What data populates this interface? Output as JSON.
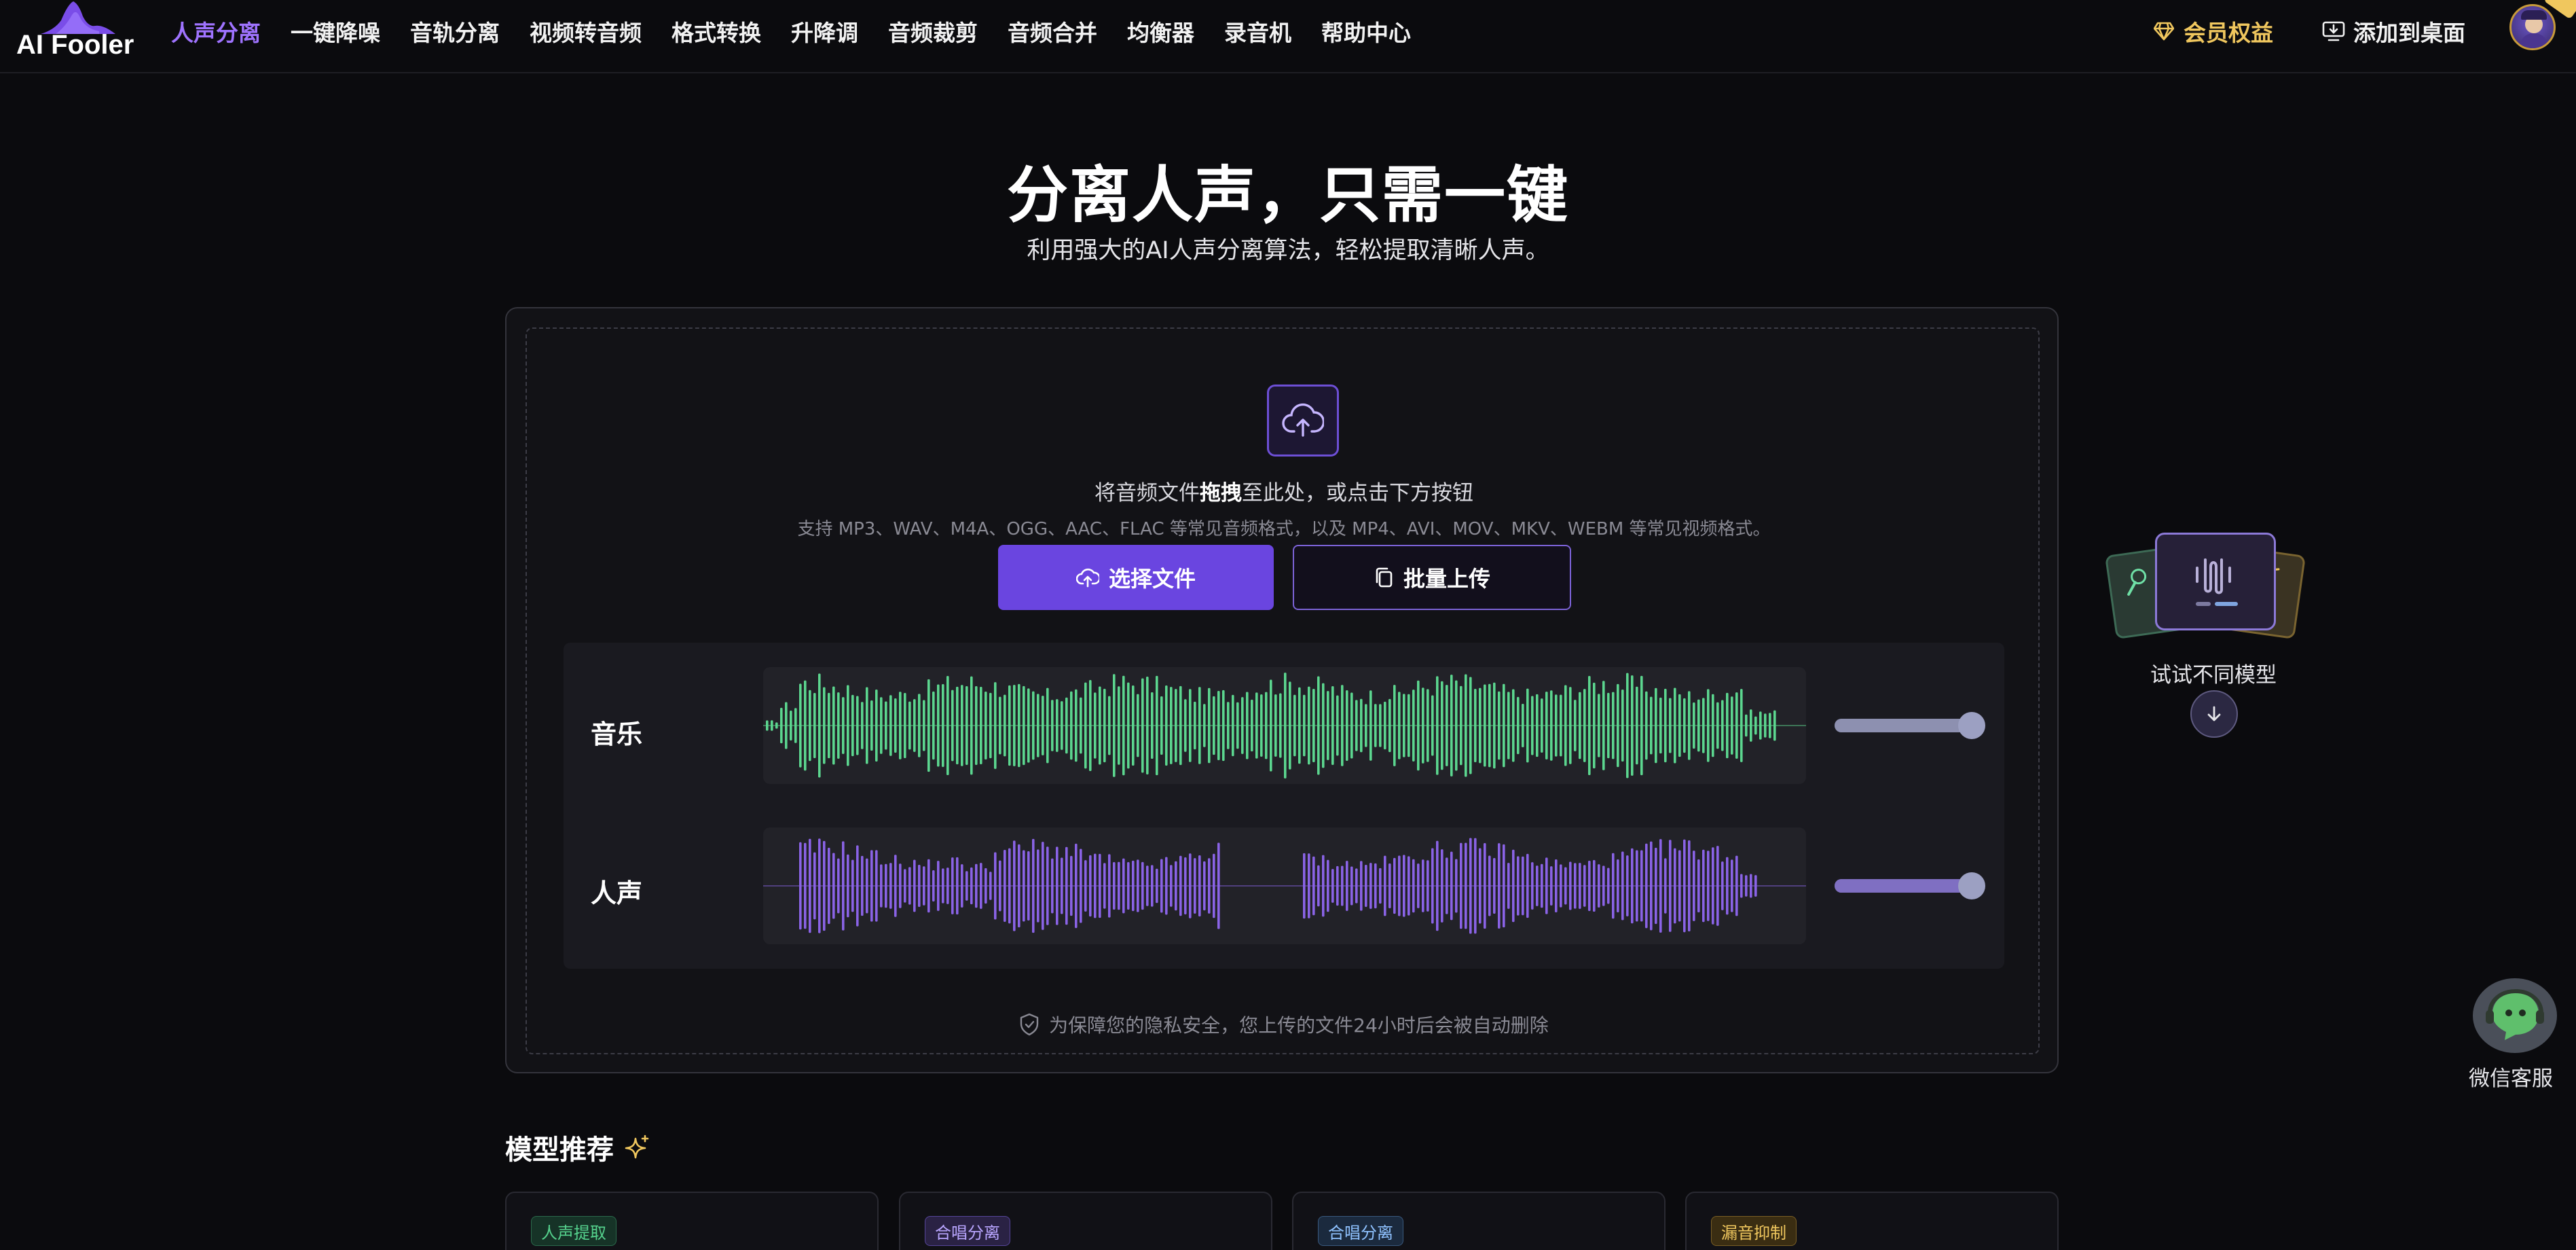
{
  "app": {
    "logo_text": "AI Fooler"
  },
  "nav": {
    "items": [
      {
        "label": "人声分离",
        "active": true
      },
      {
        "label": "一键降噪"
      },
      {
        "label": "音轨分离"
      },
      {
        "label": "视频转音频"
      },
      {
        "label": "格式转换"
      },
      {
        "label": "升降调"
      },
      {
        "label": "音频裁剪"
      },
      {
        "label": "音频合并"
      },
      {
        "label": "均衡器"
      },
      {
        "label": "录音机"
      },
      {
        "label": "帮助中心"
      }
    ],
    "vip_label": "会员权益",
    "add_desktop_label": "添加到桌面"
  },
  "hero": {
    "title": "分离人声，只需一键",
    "subtitle": "利用强大的AI人声分离算法，轻松提取清晰人声。"
  },
  "upload": {
    "drop_prefix": "将音频文件",
    "drop_bold": "拖拽",
    "drop_suffix": "至此处，或点击下方按钮",
    "formats": "支持 MP3、WAV、M4A、OGG、AAC、FLAC 等常见音频格式，以及 MP4、AVI、MOV、MKV、WEBM 等常见视频格式。",
    "select_button": "选择文件",
    "batch_button": "批量上传",
    "privacy_note": "为保障您的隐私安全，您上传的文件24小时后会被自动删除"
  },
  "tracks": [
    {
      "label": "音乐",
      "color": "#5cd68f",
      "volume": 1.0
    },
    {
      "label": "人声",
      "color": "#8a63e6",
      "volume": 1.0
    }
  ],
  "model_widget": {
    "label": "试试不同模型"
  },
  "support": {
    "label": "微信客服"
  },
  "models": {
    "section_title": "模型推荐",
    "cards": [
      {
        "tag": "人声提取",
        "tag_color": "green"
      },
      {
        "tag": "合唱分离",
        "tag_color": "purple"
      },
      {
        "tag": "合唱分离",
        "tag_color": "blue"
      },
      {
        "tag": "漏音抑制",
        "tag_color": "gold"
      }
    ]
  },
  "colors": {
    "accent": "#6a45e0",
    "nav_active": "#9f73ff",
    "vip": "#f0c75e",
    "music_wave": "#5cd68f",
    "voice_wave": "#8a63e6"
  }
}
